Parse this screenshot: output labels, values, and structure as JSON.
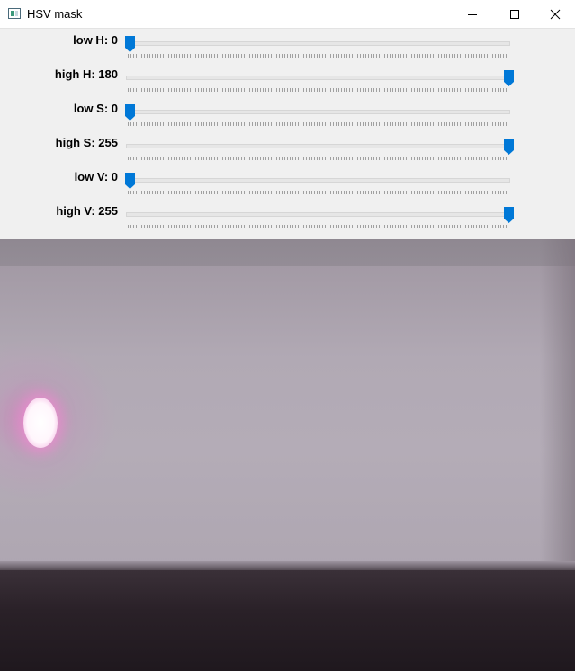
{
  "window": {
    "title": "HSV mask"
  },
  "trackbars": [
    {
      "name": "low H",
      "label": "low H: 0",
      "value": 0,
      "max": 180
    },
    {
      "name": "high H",
      "label": "high H: 180",
      "value": 180,
      "max": 180
    },
    {
      "name": "low S",
      "label": "low S: 0",
      "value": 0,
      "max": 255
    },
    {
      "name": "high S",
      "label": "high S: 255",
      "value": 255,
      "max": 255
    },
    {
      "name": "low V",
      "label": "low V: 0",
      "value": 0,
      "max": 255
    },
    {
      "name": "high V",
      "label": "high V: 255",
      "value": 255,
      "max": 255
    }
  ],
  "icons": {
    "app": "app-window-icon",
    "minimize": "minimize-icon",
    "maximize": "maximize-icon",
    "close": "close-icon",
    "thumb": "slider-thumb-icon"
  },
  "colors": {
    "thumb": "#0078d7",
    "panel_bg": "#f0f0f0",
    "titlebar_bg": "#ffffff"
  }
}
